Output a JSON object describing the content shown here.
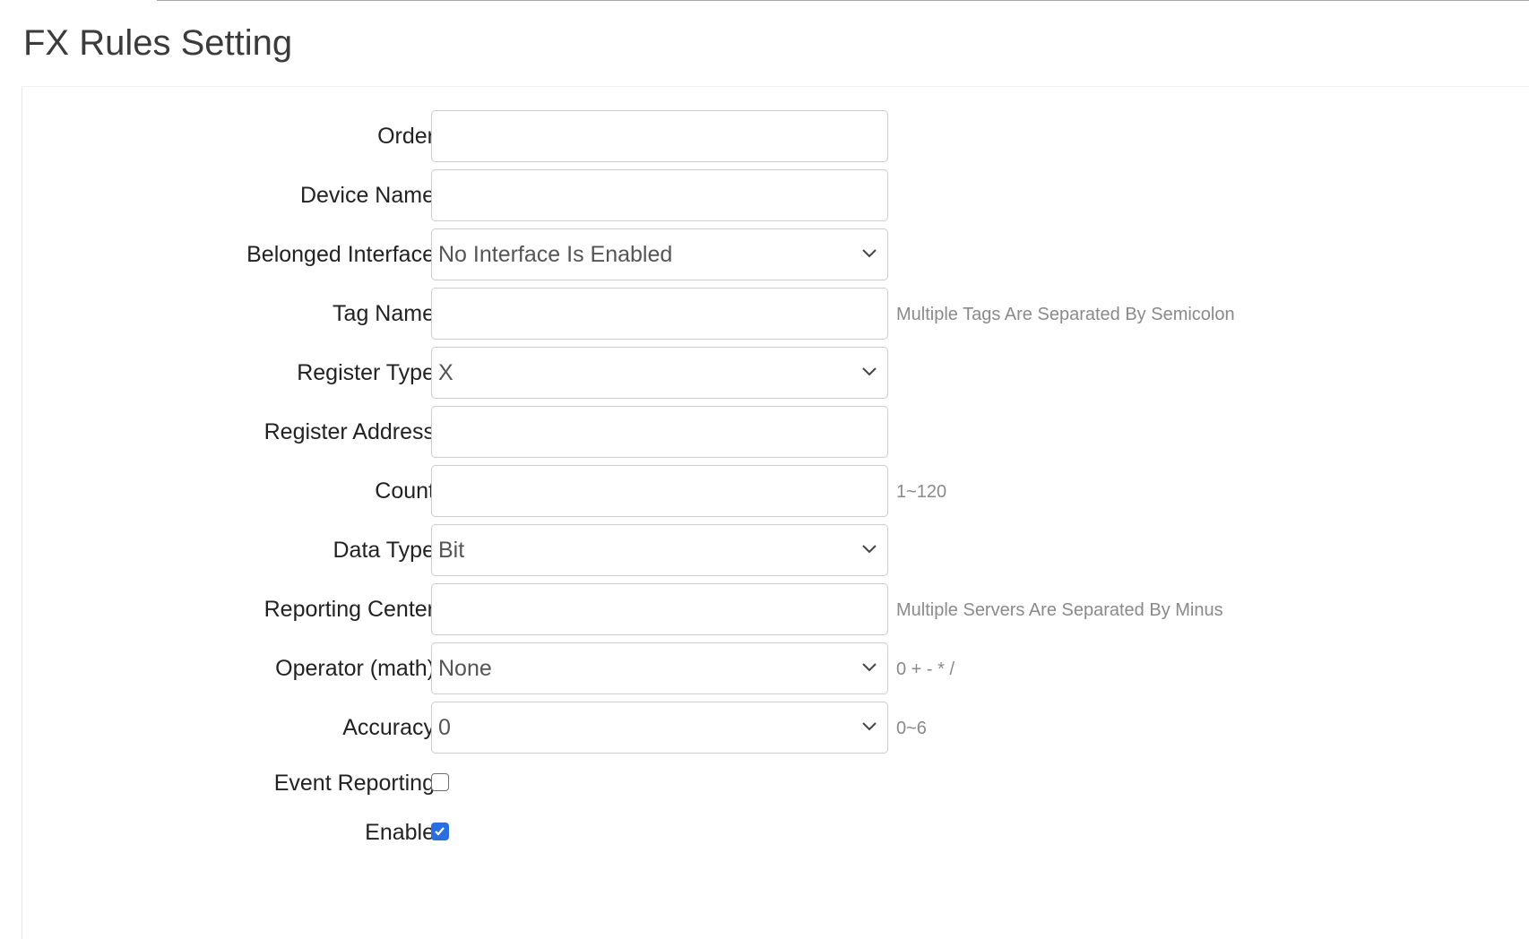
{
  "page": {
    "title": "FX Rules Setting"
  },
  "form": {
    "order": {
      "label": "Order",
      "value": ""
    },
    "device_name": {
      "label": "Device Name",
      "value": ""
    },
    "belonged_interface": {
      "label": "Belonged Interface",
      "selected": "No Interface Is Enabled"
    },
    "tag_name": {
      "label": "Tag Name",
      "value": "",
      "help": "Multiple Tags Are Separated By Semicolon"
    },
    "register_type": {
      "label": "Register Type",
      "selected": "X"
    },
    "register_address": {
      "label": "Register Address",
      "value": ""
    },
    "count": {
      "label": "Count",
      "value": "",
      "help": "1~120"
    },
    "data_type": {
      "label": "Data Type",
      "selected": "Bit"
    },
    "reporting_center": {
      "label": "Reporting Center",
      "value": "",
      "help": "Multiple Servers Are Separated By Minus"
    },
    "operator": {
      "label": "Operator (math)",
      "selected": "None",
      "help": "0 + - * /"
    },
    "accuracy": {
      "label": "Accuracy",
      "selected": "0",
      "help": "0~6"
    },
    "event_reporting": {
      "label": "Event Reporting",
      "checked": false
    },
    "enable": {
      "label": "Enable",
      "checked": true
    }
  },
  "icons": {
    "select_arrow": "chevron-down-icon",
    "checkbox_mark": "checkmark-icon"
  },
  "colors": {
    "checkbox_checked": "#2a6fe0",
    "help_text": "#8a8a8a",
    "input_border": "#cccccc"
  }
}
